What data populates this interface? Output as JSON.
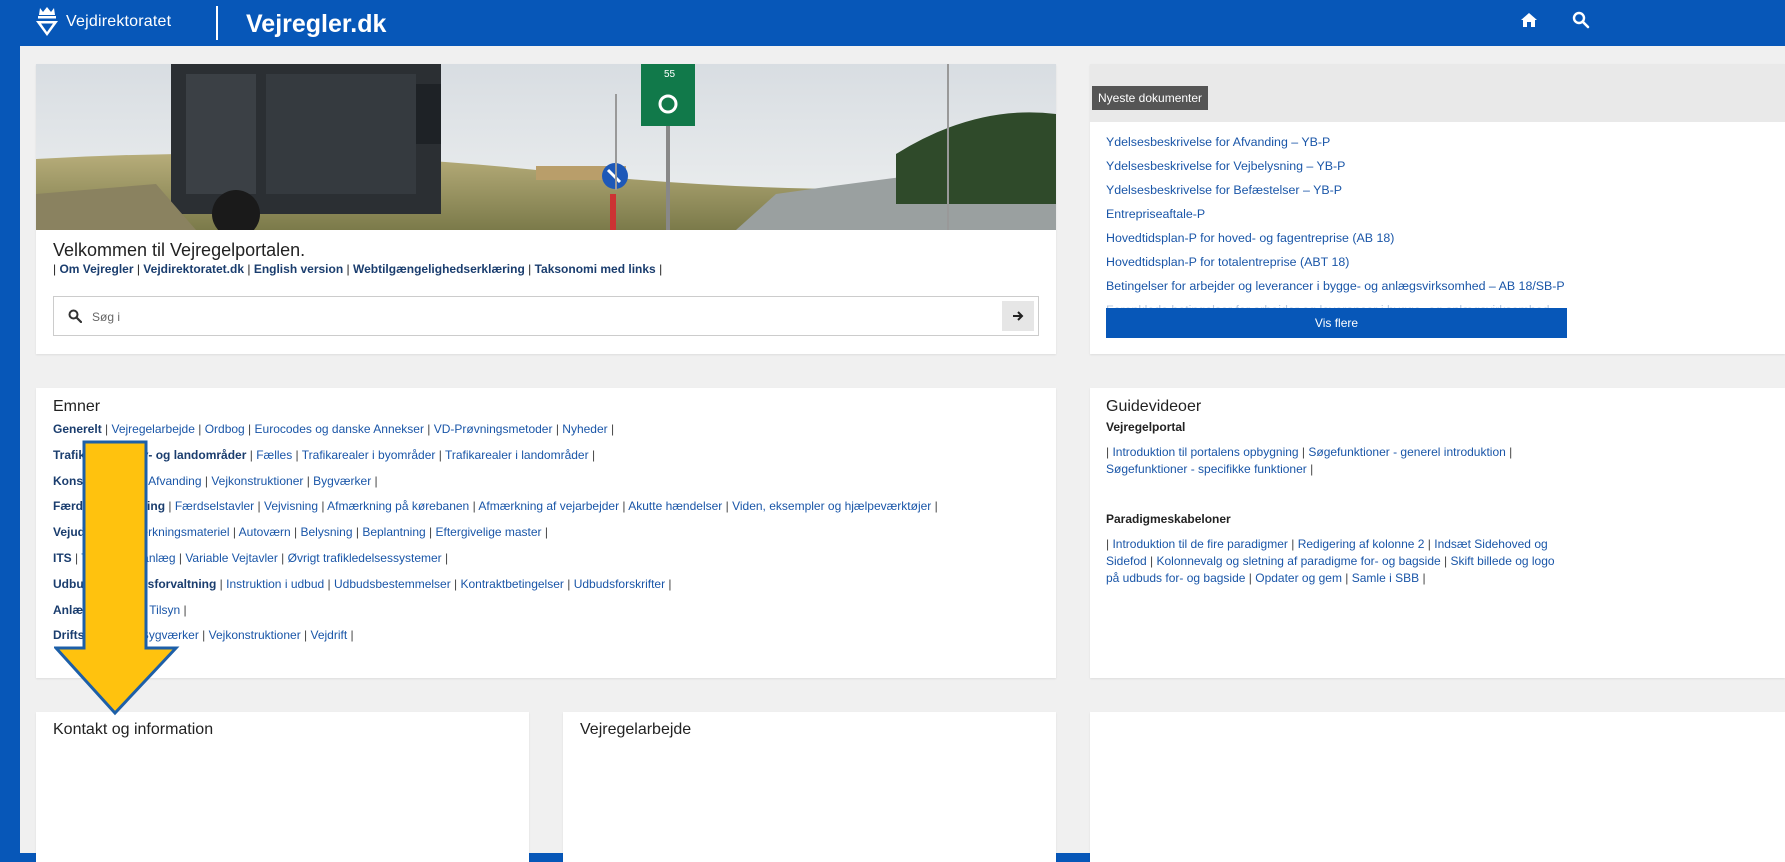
{
  "header": {
    "brand_text": "Vejdirektoratet",
    "site_title": "Vejregler.dk",
    "icons": [
      "home-icon",
      "search-icon"
    ]
  },
  "hero": {
    "welcome": "Velkommen til Vejregelportalen.",
    "links": [
      "Om Vejregler",
      "Vejdirektoratet.dk",
      "English version",
      "Webtilgængelighedserklæring",
      "Taksonomi med links"
    ],
    "search_placeholder": "Søg i",
    "sign_number": "55"
  },
  "news": {
    "badge": "Nyeste dokumenter",
    "items": [
      "Ydelsesbeskrivelse for Afvanding – YB-P",
      "Ydelsesbeskrivelse for Vejbelysning – YB-P",
      "Ydelsesbeskrivelse for Befæstelser – YB-P",
      "Entrepriseaftale-P",
      "Hovedtidsplan-P for hoved- og fagentreprise (AB 18)",
      "Hovedtidsplan-P for totalentreprise (ABT 18)",
      "Betingelser for arbejder og leverancer i bygge- og anlægsvirksomhed – AB 18/SB-P",
      "Forenklede betingelser for arbejder og leverancer i bygge- og anlægsvirksomhed"
    ],
    "more_button": "Vis flere"
  },
  "emner": {
    "title": "Emner",
    "rows": [
      {
        "head": "Generelt",
        "links": [
          "Vejregelarbejde",
          "Ordbog",
          "Eurocodes og danske Annekser",
          "VD-Prøvningsmetoder",
          "Nyheder"
        ]
      },
      {
        "head": "Trafikarealer i by- og landområder",
        "links": [
          "Fælles",
          "Trafikarealer i byområder",
          "Trafikarealer i landområder"
        ]
      },
      {
        "head": "Konstruktioner",
        "links": [
          "Afvanding",
          "Vejkonstruktioner",
          "Bygværker"
        ]
      },
      {
        "head": "Færdselsregulering",
        "links": [
          "Færdselstavler",
          "Vejvisning",
          "Afmærkning på kørebanen",
          "Afmærkning af vejarbejder",
          "Akutte hændelser",
          "Viden, eksempler og hjælpeværktøjer"
        ]
      },
      {
        "head": "Vejudstyr",
        "links": [
          "Afmærkningsmateriel",
          "Autoværn",
          "Belysning",
          "Beplantning",
          "Eftergivelige master"
        ]
      },
      {
        "head": "ITS",
        "links": [
          "Trafiksignalanlæg",
          "Variable Vejtavler",
          "Øvrigt trafikledelsessystemer"
        ]
      },
      {
        "head": "Udbud og anlægsforvaltning",
        "links": [
          "Instruktion i udbud",
          "Udbudsbestemmelser",
          "Kontraktbetingelser",
          "Udbudsforskrifter"
        ]
      },
      {
        "head": "Anlægsarbejde",
        "links": [
          "Tilsyn"
        ]
      },
      {
        "head": "Driftsopgaver",
        "links": [
          "Bygværker",
          "Vejkonstruktioner",
          "Vejdrift"
        ]
      }
    ]
  },
  "guide": {
    "title": "Guidevideoer",
    "section1_title": "Vejregelportal",
    "section1_links": [
      "Introduktion til portalens opbygning",
      "Søgefunktioner - generel introduktion",
      "Søgefunktioner - specifikke funktioner"
    ],
    "section2_title": "Paradigmeskabeloner",
    "section2_links": [
      "Introduktion til de fire paradigmer",
      "Redigering af kolonne 2",
      "Indsæt Sidehoved og Sidefod",
      "Kolonnevalg og sletning af paradigme for- og bagside",
      "Skift billede og logo på udbuds for- og bagside",
      "Opdater og gem",
      "Samle i SBB"
    ]
  },
  "bottom": {
    "contact_title": "Kontakt og information",
    "work_title": "Vejregelarbejde"
  },
  "colors": {
    "brand_blue": "#0757b8",
    "link_blue": "#1a56a8",
    "arrow_fill": "#ffc20e"
  }
}
